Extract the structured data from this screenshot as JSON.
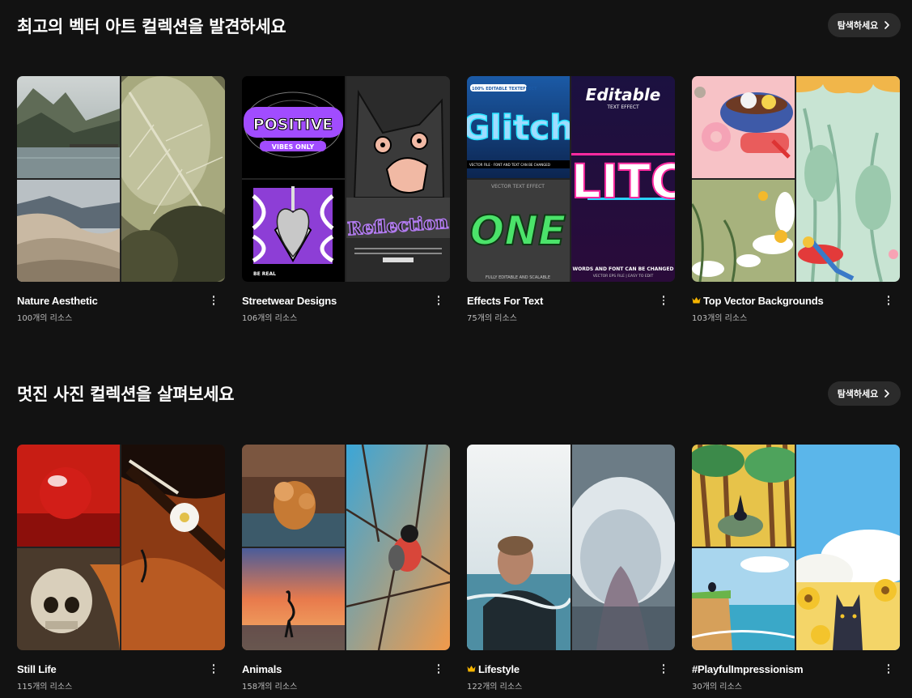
{
  "sections": [
    {
      "title": "최고의 벡터 아트 컬렉션을 발견하세요",
      "explore_label": "탐색하세요",
      "cards": [
        {
          "title": "Nature Aesthetic",
          "count": "100개의 리소스",
          "premium": false
        },
        {
          "title": "Streetwear Designs",
          "count": "106개의 리소스",
          "premium": false
        },
        {
          "title": "Effects For Text",
          "count": "75개의 리소스",
          "premium": false
        },
        {
          "title": "Top Vector Backgrounds",
          "count": "103개의 리소스",
          "premium": true
        }
      ]
    },
    {
      "title": "멋진 사진 컬렉션을 살펴보세요",
      "explore_label": "탐색하세요",
      "cards": [
        {
          "title": "Still Life",
          "count": "115개의 리소스",
          "premium": false
        },
        {
          "title": "Animals",
          "count": "158개의 리소스",
          "premium": false
        },
        {
          "title": "Lifestyle",
          "count": "122개의 리소스",
          "premium": true
        },
        {
          "title": "#PlayfulImpressionism",
          "count": "30개의 리소스",
          "premium": false
        }
      ]
    }
  ],
  "thumb_text": {
    "positive": "POSITIVE",
    "vibes_only": "VIBES ONLY",
    "be_real": "BE REAL",
    "reflection": "Reflection",
    "editable_textefect": "100% EDITABLE TEXTEFFECT",
    "glitch": "Glitch",
    "vector_file_line": "VECTOR FILE · FONT AND TEXT CAN BE CHANGED",
    "vector_text_effect": "VECTOR TEXT EFFECT",
    "green_word": "ONE",
    "fully_editable": "FULLY EDITABLE AND SCALABLE",
    "editable": "Editable",
    "text_effect": "TEXT EFFECT",
    "glitch_short": "LITC",
    "words_font_line": "WORDS AND FONT CAN BE CHANGED",
    "vector_eps_line": "VECTOR EPS FILE | EASY TO EDIT"
  },
  "colors": {
    "background": "#121212",
    "button_bg": "#2b2b2b",
    "crown": "#f5b400",
    "count_text": "#bdbdbd"
  },
  "icons": {
    "explore_arrow": "chevron-right-icon",
    "more": "more-vertical-icon",
    "premium": "crown-icon"
  }
}
